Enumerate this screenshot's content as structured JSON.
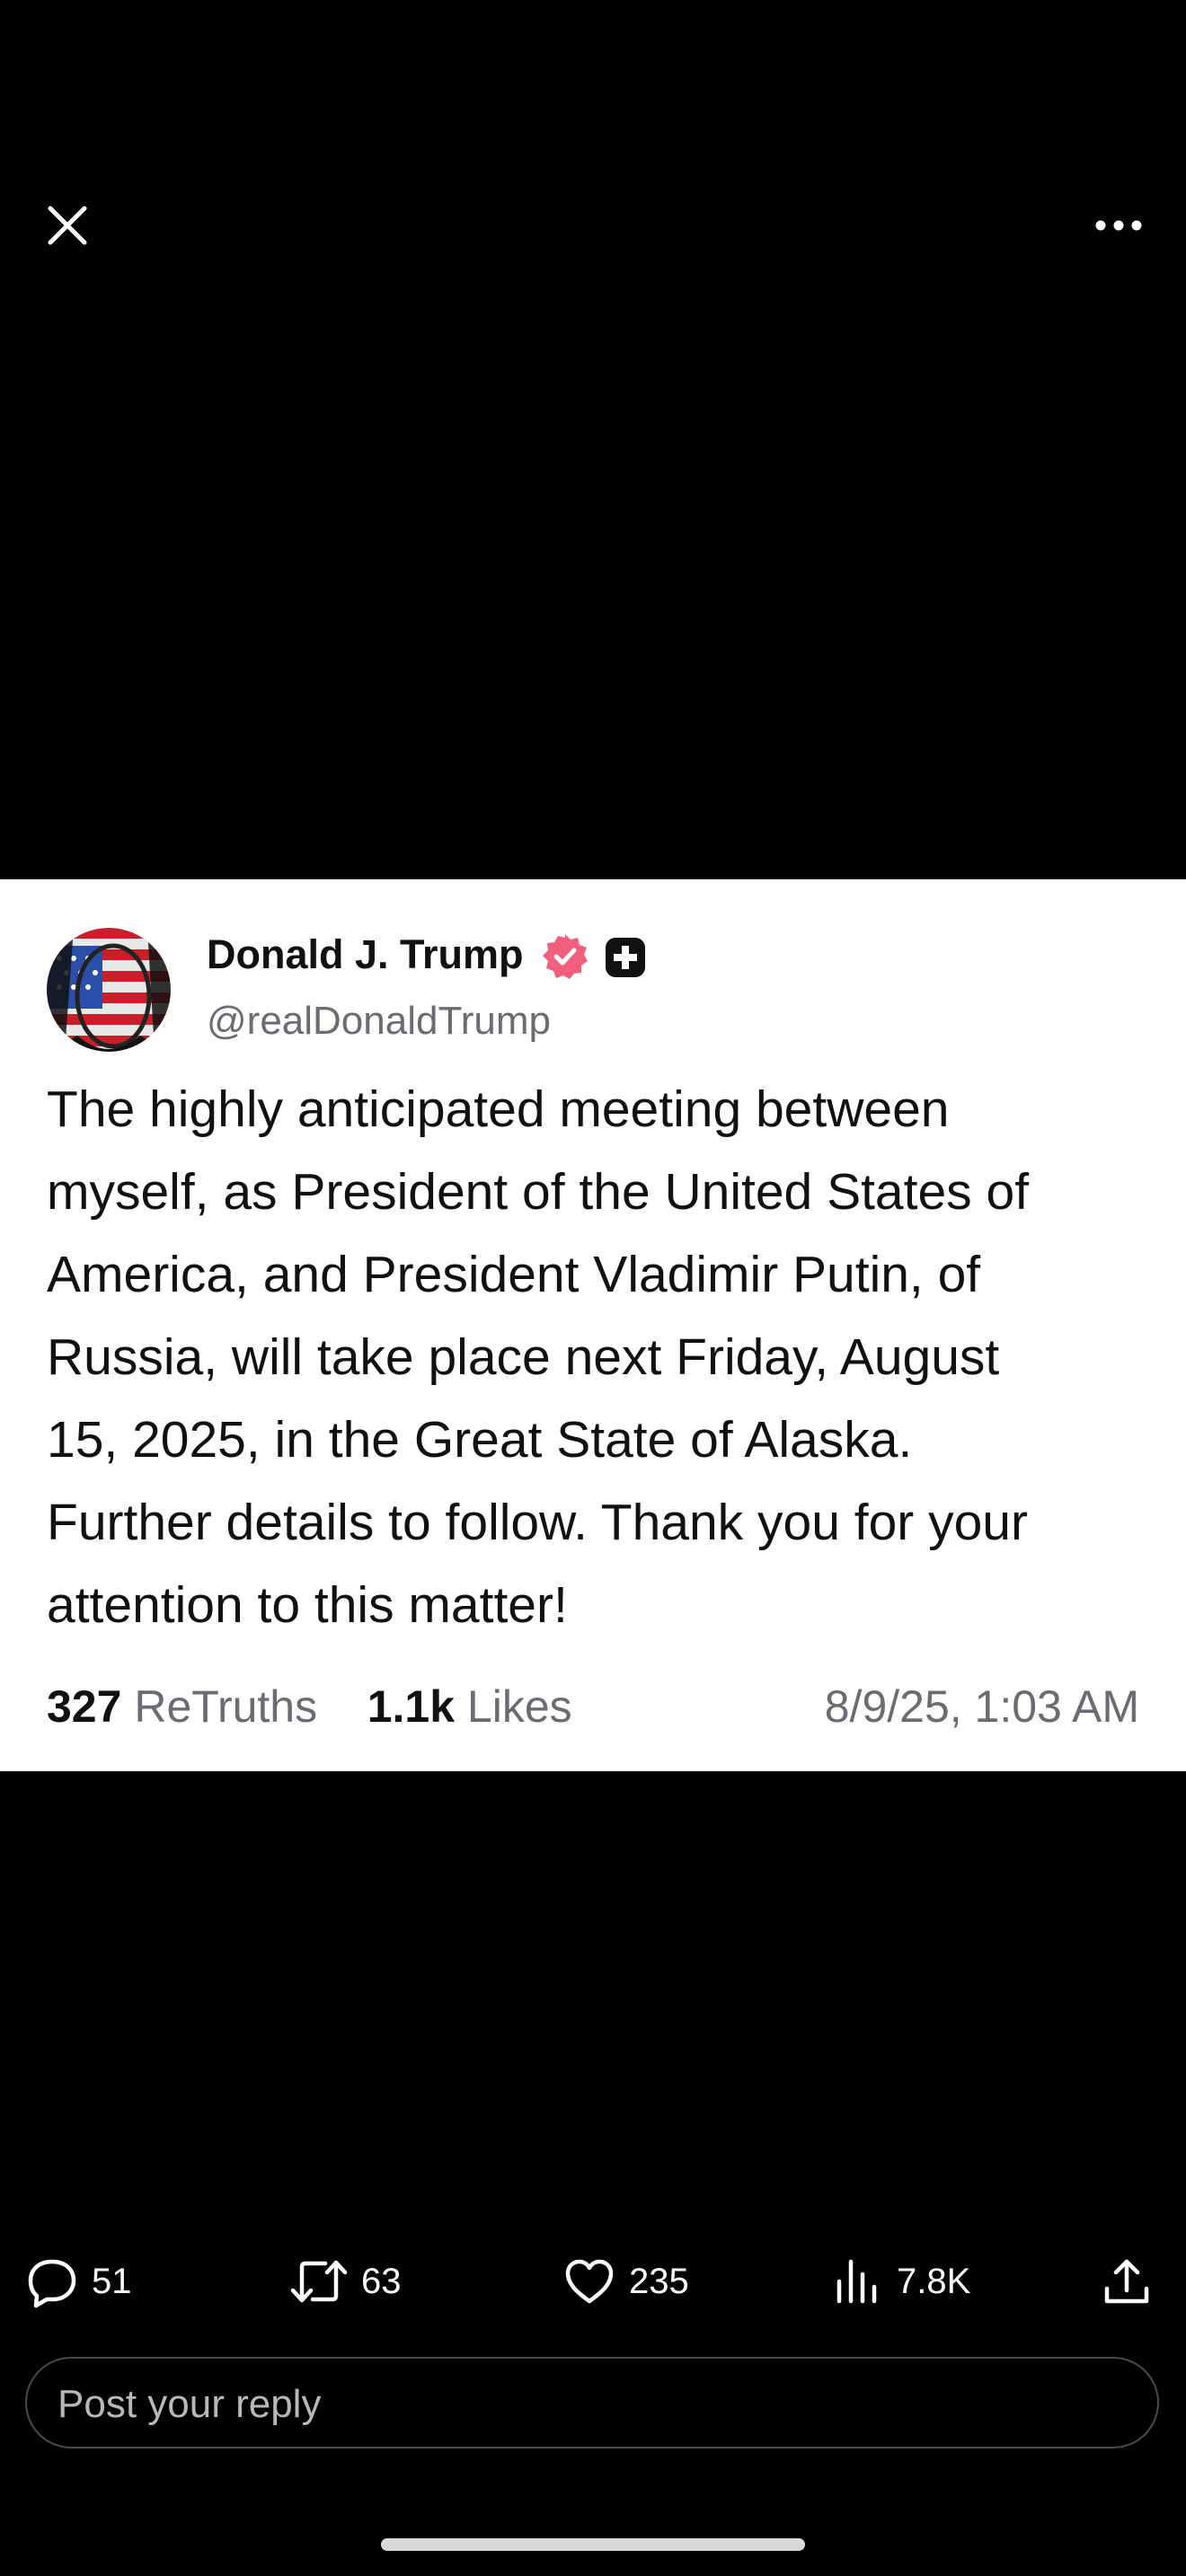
{
  "header": {
    "close_icon": "close-icon",
    "more_icon": "more-horizontal-icon"
  },
  "post": {
    "author_name": "Donald J. Trump",
    "handle": "@realDonaldTrump",
    "verified_color": "#f25f7c",
    "text_lines": [
      "The highly anticipated meeting between",
      "myself, as President of the United States of",
      "America, and President Vladimir Putin, of",
      "Russia, will take place next Friday, August",
      "15, 2025, in the Great State of Alaska.",
      "Further details to follow. Thank you for your",
      "attention to this matter!"
    ],
    "retruths_count": "327",
    "retruths_label": "ReTruths",
    "likes_count": "1.1k",
    "likes_label": "Likes",
    "timestamp": "8/9/25, 1:03 AM"
  },
  "actions": {
    "replies": "51",
    "reposts": "63",
    "likes": "235",
    "views": "7.8K"
  },
  "reply": {
    "placeholder": "Post your reply"
  }
}
